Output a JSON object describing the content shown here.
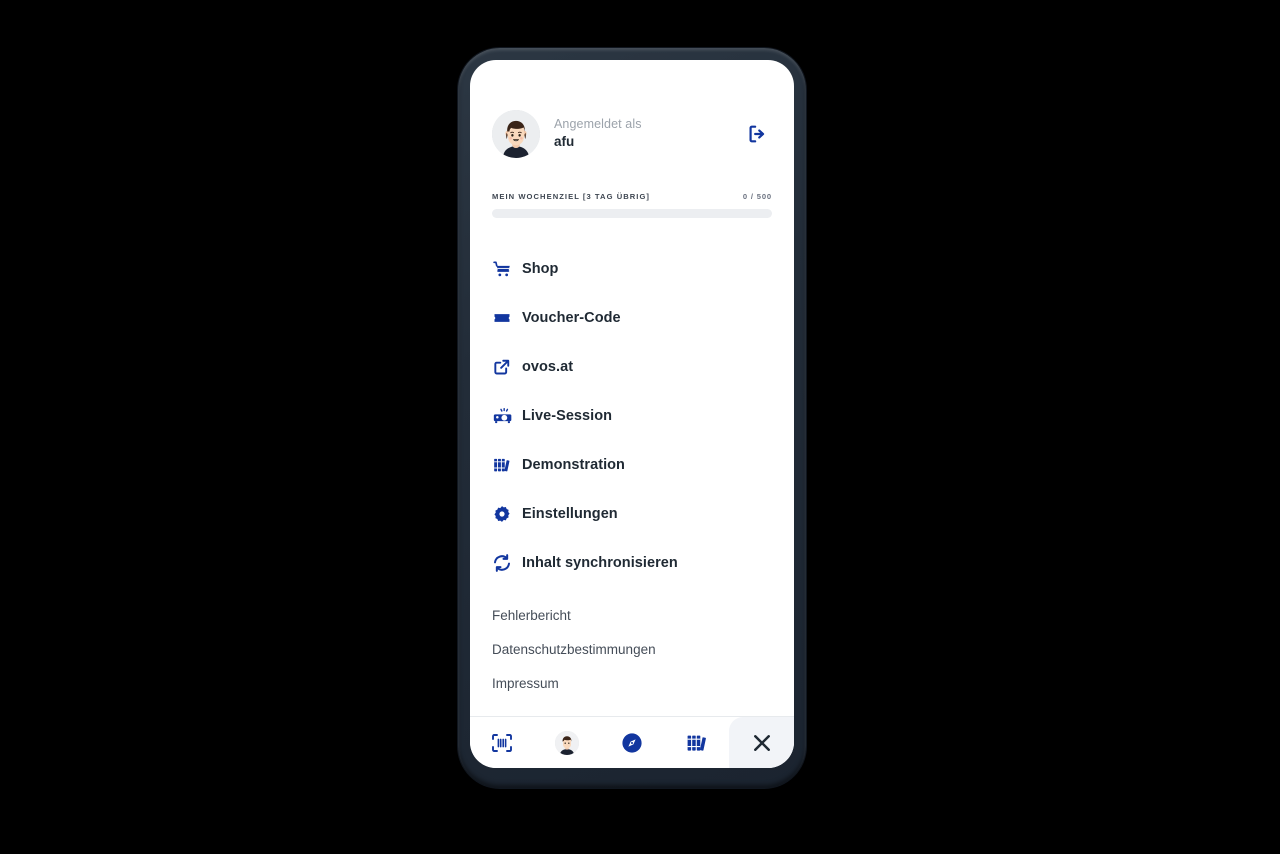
{
  "device": {
    "frame_color": "#222c38",
    "screen_bg": "#ffffff"
  },
  "theme": {
    "accent_blue": "#12369f",
    "text_dark": "#1f2933",
    "text_muted": "#9ca3ab",
    "track_gray": "#eceef1",
    "close_btn_bg": "#f2f4f8"
  },
  "account": {
    "logged_in_label": "Angemeldet als",
    "username": "afu",
    "avatar_icon": "user-avatar",
    "logout_icon": "logout-icon"
  },
  "weekly_goal": {
    "label": "MEIN WOCHENZIEL [3 TAG ÜBRIG]",
    "count": "0 / 500",
    "current": 0,
    "target": 500,
    "percent": 0
  },
  "menu": {
    "items": [
      {
        "label": "Shop",
        "icon": "shopping-cart-icon"
      },
      {
        "label": "Voucher-Code",
        "icon": "ticket-icon"
      },
      {
        "label": "ovos.at",
        "icon": "external-link-icon"
      },
      {
        "label": "Live-Session",
        "icon": "projector-icon"
      },
      {
        "label": "Demonstration",
        "icon": "books-icon"
      },
      {
        "label": "Einstellungen",
        "icon": "gear-icon"
      },
      {
        "label": "Inhalt synchronisieren",
        "icon": "sync-icon"
      }
    ]
  },
  "legal": {
    "items": [
      {
        "label": "Fehlerbericht"
      },
      {
        "label": "Datenschutzbestimmungen"
      },
      {
        "label": "Impressum"
      }
    ]
  },
  "bottom_nav": {
    "items": [
      {
        "name": "scan",
        "icon": "barcode-scan-icon"
      },
      {
        "name": "profile",
        "icon": "avatar-icon"
      },
      {
        "name": "explore",
        "icon": "compass-icon"
      },
      {
        "name": "library",
        "icon": "books-icon"
      },
      {
        "name": "close",
        "icon": "close-icon"
      }
    ]
  }
}
